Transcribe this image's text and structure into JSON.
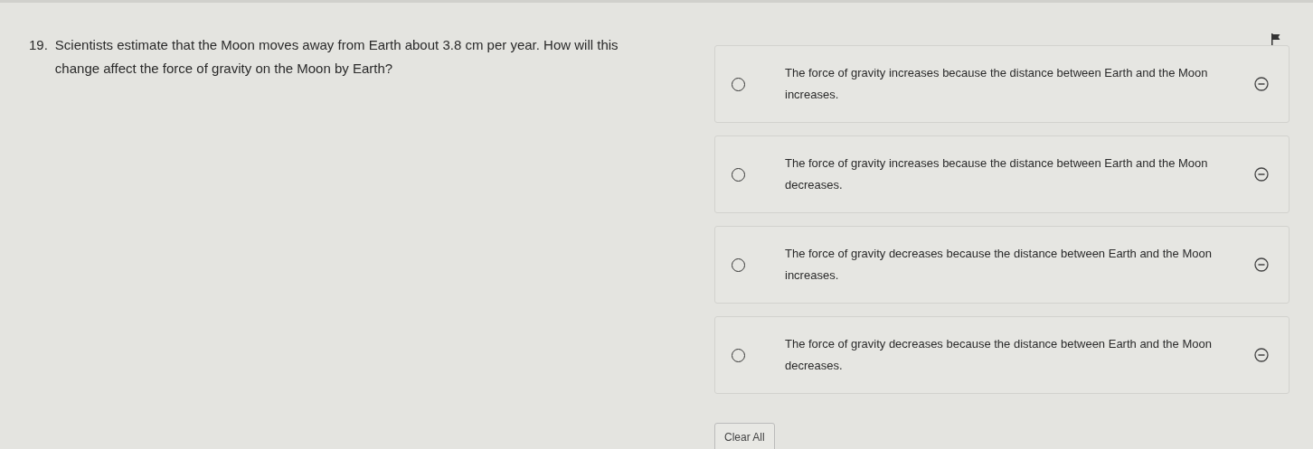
{
  "question": {
    "number": "19.",
    "text": "Scientists estimate that the Moon moves away from Earth about 3.8 cm per year. How will this change affect the force of gravity on the Moon by Earth?",
    "flagged": true
  },
  "options": [
    {
      "text": "The force of gravity increases because the distance between Earth and the Moon increases.",
      "selected": false
    },
    {
      "text": "The force of gravity increases because the distance between Earth and the Moon decreases.",
      "selected": false
    },
    {
      "text": "The force of gravity decreases because the distance between Earth and the Moon increases.",
      "selected": false
    },
    {
      "text": "The force of gravity decreases because the distance between Earth and the Moon decreases.",
      "selected": false
    }
  ],
  "clear_button": "Clear All"
}
